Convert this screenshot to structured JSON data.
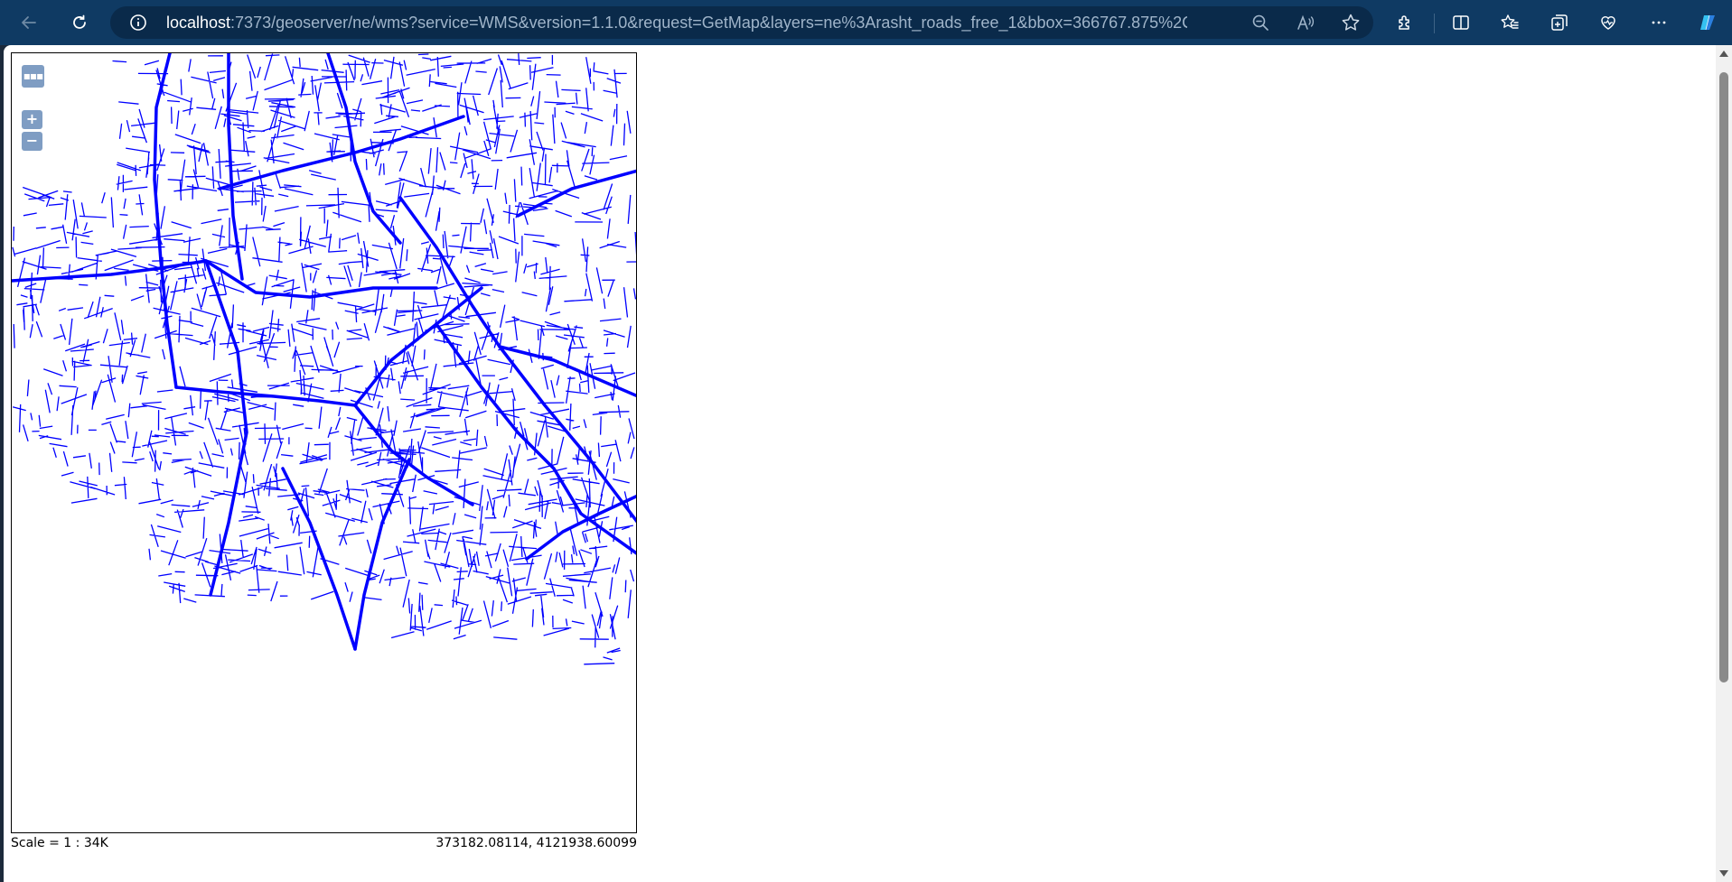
{
  "browser": {
    "url_host": "localhost",
    "url_rest": ":7373/geoserver/ne/wms?service=WMS&version=1.1.0&request=GetMap&layers=ne%3Arasht_roads_free_1&bbox=366767.875%2C4114114....",
    "icons": [
      "back-icon",
      "refresh-icon",
      "info-icon",
      "zoom-out-icon",
      "read-aloud-icon",
      "favorite-star-icon",
      "extensions-icon",
      "split-screen-icon",
      "favorites-icon",
      "collections-icon",
      "browser-essentials-icon",
      "more-icon",
      "copilot-icon"
    ]
  },
  "map": {
    "toggle_label": "▪▪▪",
    "zoom_in_label": "+",
    "zoom_out_label": "−",
    "scale_text": "Scale = 1 : 34K",
    "coordinates_text": "373182.08114, 4121938.60099",
    "road_color": "#0000ff"
  }
}
